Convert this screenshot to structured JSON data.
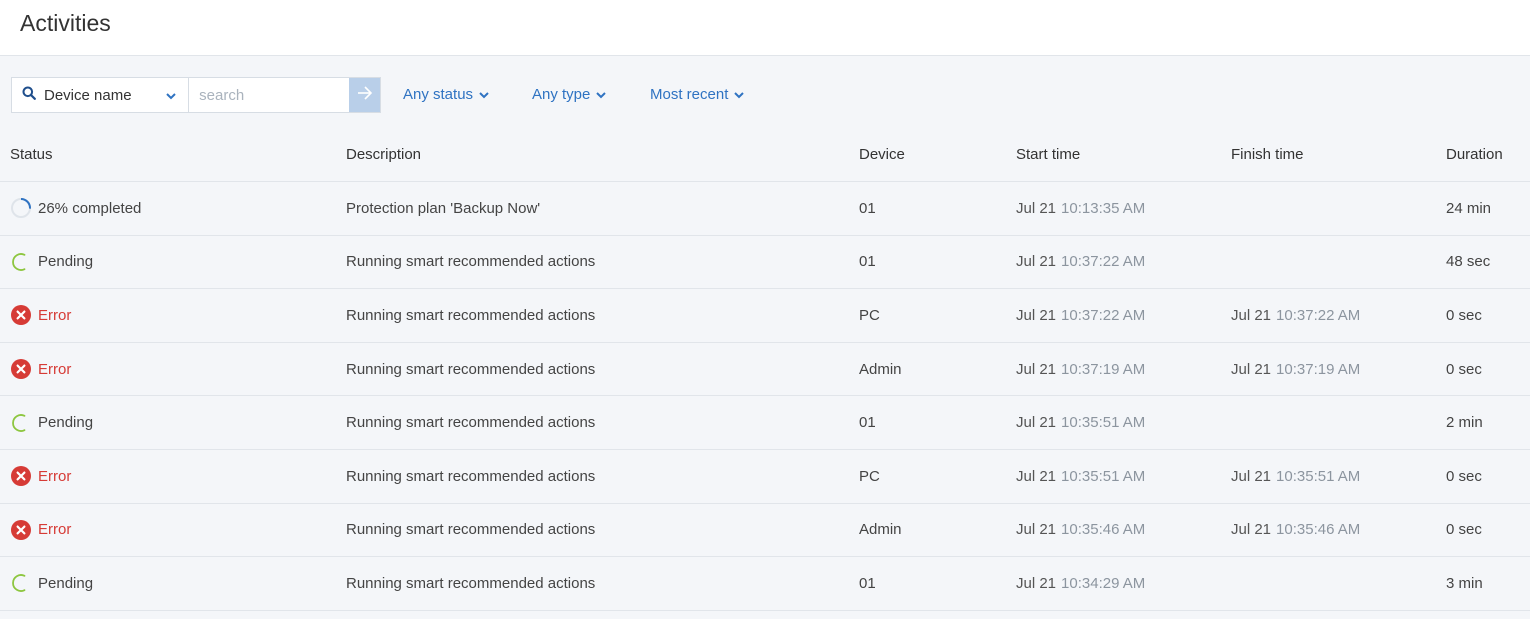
{
  "page": {
    "title": "Activities"
  },
  "toolbar": {
    "device_select_label": "Device name",
    "search_placeholder": "search",
    "filters": {
      "status": "Any status",
      "type": "Any type",
      "sort": "Most recent"
    }
  },
  "table": {
    "headers": {
      "status": "Status",
      "description": "Description",
      "device": "Device",
      "start_time": "Start time",
      "finish_time": "Finish time",
      "duration": "Duration"
    },
    "rows": [
      {
        "status": "26% completed",
        "status_kind": "progress",
        "progress": 0.26,
        "description": "Protection plan 'Backup Now'",
        "device": "01",
        "start_date": "Jul 21",
        "start_clock": "10:13:35 AM",
        "finish_date": "",
        "finish_clock": "",
        "duration": "24 min"
      },
      {
        "status": "Pending",
        "status_kind": "pending",
        "description": "Running smart recommended actions",
        "device": "01",
        "start_date": "Jul 21",
        "start_clock": "10:37:22 AM",
        "finish_date": "",
        "finish_clock": "",
        "duration": "48 sec"
      },
      {
        "status": "Error",
        "status_kind": "error",
        "description": "Running smart recommended actions",
        "device": "PC",
        "start_date": "Jul 21",
        "start_clock": "10:37:22 AM",
        "finish_date": "Jul 21",
        "finish_clock": "10:37:22 AM",
        "duration": "0 sec"
      },
      {
        "status": "Error",
        "status_kind": "error",
        "description": "Running smart recommended actions",
        "device": "Admin",
        "start_date": "Jul 21",
        "start_clock": "10:37:19 AM",
        "finish_date": "Jul 21",
        "finish_clock": "10:37:19 AM",
        "duration": "0 sec"
      },
      {
        "status": "Pending",
        "status_kind": "pending",
        "description": "Running smart recommended actions",
        "device": "01",
        "start_date": "Jul 21",
        "start_clock": "10:35:51 AM",
        "finish_date": "",
        "finish_clock": "",
        "duration": "2 min"
      },
      {
        "status": "Error",
        "status_kind": "error",
        "description": "Running smart recommended actions",
        "device": "PC",
        "start_date": "Jul 21",
        "start_clock": "10:35:51 AM",
        "finish_date": "Jul 21",
        "finish_clock": "10:35:51 AM",
        "duration": "0 sec"
      },
      {
        "status": "Error",
        "status_kind": "error",
        "description": "Running smart recommended actions",
        "device": "Admin",
        "start_date": "Jul 21",
        "start_clock": "10:35:46 AM",
        "finish_date": "Jul 21",
        "finish_clock": "10:35:46 AM",
        "duration": "0 sec"
      },
      {
        "status": "Pending",
        "status_kind": "pending",
        "description": "Running smart recommended actions",
        "device": "01",
        "start_date": "Jul 21",
        "start_clock": "10:34:29 AM",
        "finish_date": "",
        "finish_clock": "",
        "duration": "3 min"
      }
    ]
  },
  "colors": {
    "accent": "#2f73c2",
    "error": "#d63b36",
    "pending": "#8dc63f",
    "progress": "#2f73c2"
  },
  "icons": {
    "search": "search-icon",
    "chevron": "chevron-down-icon",
    "go": "arrow-right-icon",
    "error": "error-icon",
    "pending": "pending-icon",
    "progress": "progress-icon"
  }
}
